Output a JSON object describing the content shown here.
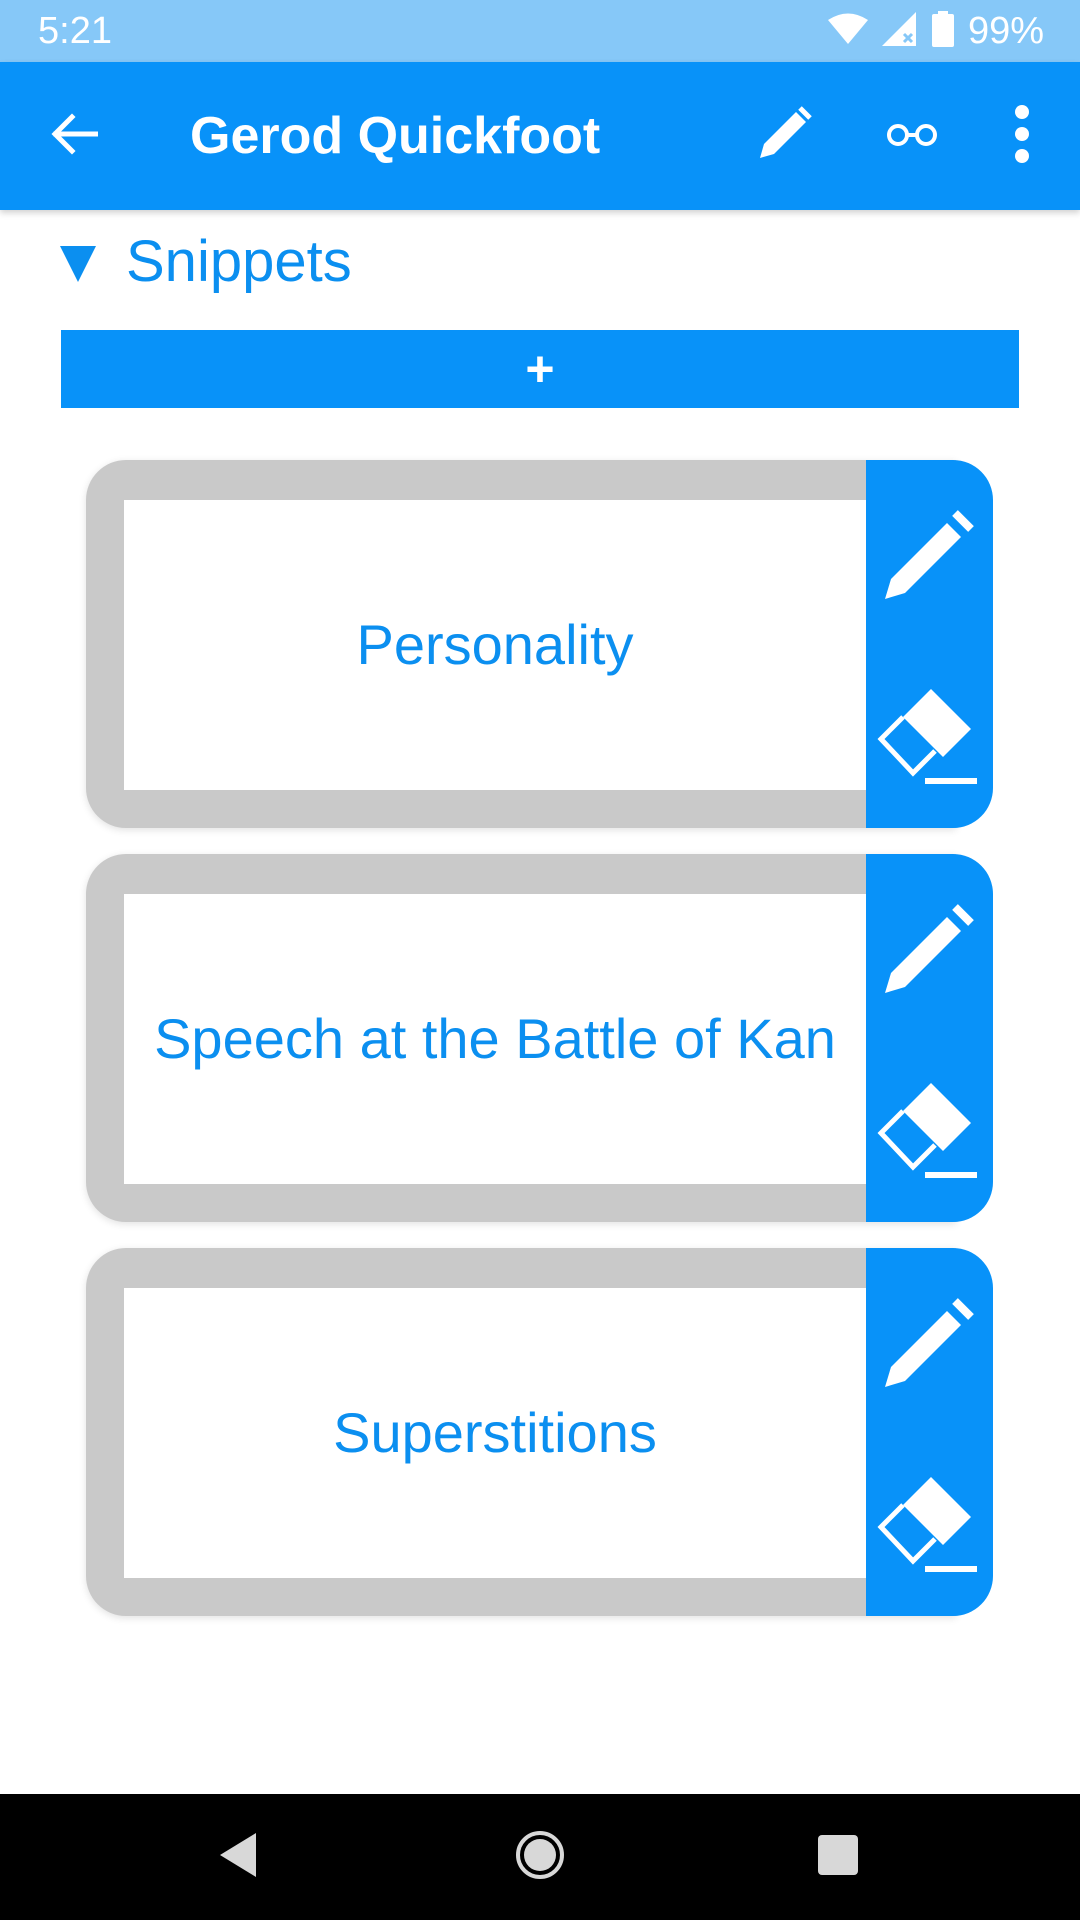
{
  "status_bar": {
    "time": "5:21",
    "battery": "99%",
    "icons": [
      "wifi-icon",
      "signal-icon",
      "battery-icon"
    ]
  },
  "app_bar": {
    "title": "Gerod Quickfoot",
    "icons": [
      "back-arrow-icon",
      "pencil-icon",
      "glasses-icon",
      "more-vert-icon"
    ]
  },
  "section": {
    "title": "Snippets",
    "add_label": "+"
  },
  "snippets": [
    {
      "label": "Personality"
    },
    {
      "label": "Speech at the Battle of Kan"
    },
    {
      "label": "Superstitions"
    }
  ],
  "colors": {
    "status_bar": "#86c8f8",
    "accent": "#0892f9",
    "text_accent": "#0b8ff0",
    "card_frame": "#c9c9c9"
  }
}
